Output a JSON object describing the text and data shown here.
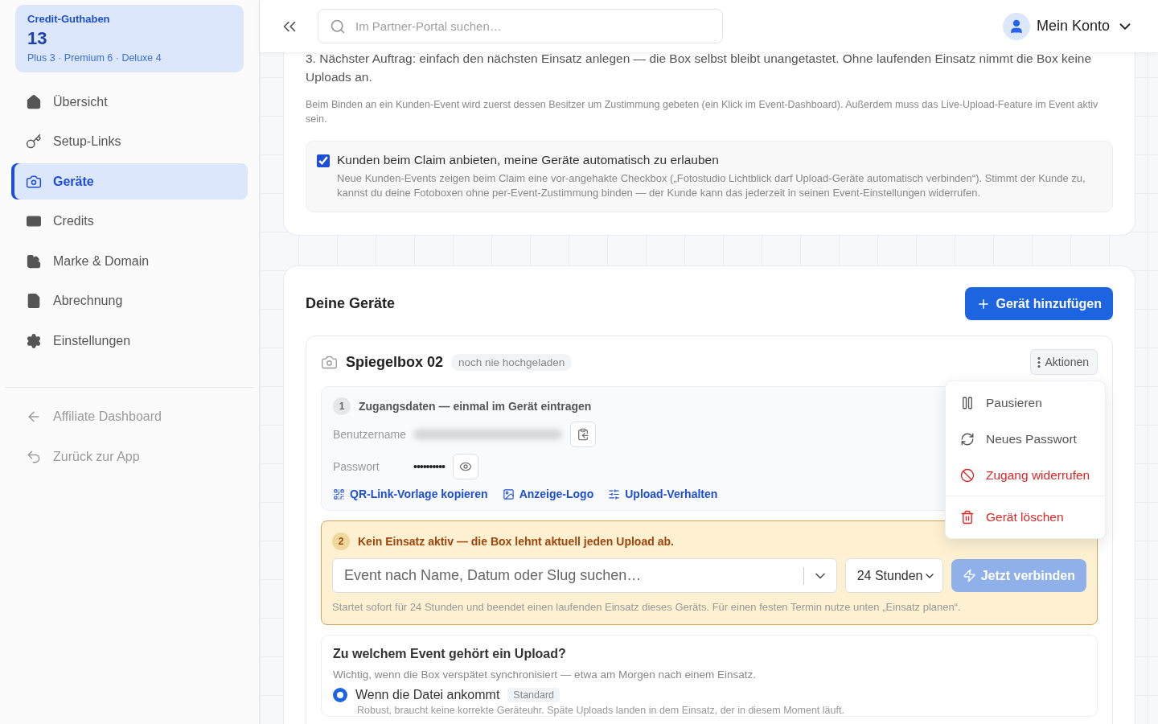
{
  "sidebar": {
    "credit": {
      "title": "Credit-Guthaben",
      "total": "13",
      "breakdown": "Plus 3 · Premium 6 · Deluxe 4"
    },
    "nav": [
      {
        "label": "Übersicht",
        "selected": false
      },
      {
        "label": "Setup-Links",
        "selected": false
      },
      {
        "label": "Geräte",
        "selected": true
      },
      {
        "label": "Credits",
        "selected": false
      },
      {
        "label": "Marke & Domain",
        "selected": false
      },
      {
        "label": "Abrechnung",
        "selected": false
      },
      {
        "label": "Einstellungen",
        "selected": false
      }
    ],
    "footer_links": [
      {
        "label": "Affiliate Dashboard"
      },
      {
        "label": "Zurück zur App"
      }
    ]
  },
  "topbar": {
    "search": {
      "placeholder": "Im Partner-Portal suchen…"
    },
    "account": "Mein Konto"
  },
  "intro": {
    "step_text": "3. Nächster Auftrag: einfach den nächsten Einsatz anlegen — die Box selbst bleibt unangetastet. Ohne laufenden Einsatz nimmt die Box keine Uploads an.",
    "note": "Beim Binden an ein Kunden-Event wird zuerst dessen Besitzer um Zustimmung gebeten (ein Klick im Event-Dashboard). Außerdem muss das Live-Upload-Feature im Event aktiv sein.",
    "consent": {
      "checked": true,
      "label": "Kunden beim Claim anbieten, meine Geräte automatisch zu erlauben",
      "description": "Neue Kunden-Events zeigen beim Claim eine vor-angehakte Checkbox („Fotostudio Lichtblick darf Upload-Geräte automatisch verbinden“). Stimmt der Kunde zu, kannst du deine Fotoboxen ohne per-Event-Zustimmung binden — der Kunde kann das jederzeit in seinen Event-Einstellungen widerrufen."
    }
  },
  "devices": {
    "title": "Deine Geräte",
    "add_button": "Gerät hinzufügen",
    "device": {
      "name": "Spiegelbox 02",
      "status": "noch nie hochgeladen",
      "actions_button": "Aktionen",
      "step1": {
        "number": "1",
        "title": "Zugangsdaten — einmal im Gerät eintragen",
        "username_label": "Benutzername",
        "password_label": "Passwort",
        "password_value": "••••••••••",
        "links": [
          {
            "label": "QR-Link-Vorlage kopieren"
          },
          {
            "label": "Anzeige-Logo"
          },
          {
            "label": "Upload-Verhalten"
          }
        ]
      },
      "step2": {
        "number": "2",
        "warning": "Kein Einsatz aktiv — die Box lehnt aktuell jeden Upload ab.",
        "event_placeholder": "Event nach Name, Datum oder Slug suchen…",
        "duration": "24 Stunden",
        "connect_button": "Jetzt verbinden",
        "connect_disabled": true,
        "hint": "Startet sofort für 24 Stunden und beendet einen laufenden Einsatz dieses Geräts. Für einen festen Termin nutze unten „Einsatz planen“."
      },
      "assignment": {
        "title": "Zu welchem Event gehört ein Upload?",
        "description": "Wichtig, wenn die Box verspätet synchronisiert — etwa am Morgen nach einem Einsatz.",
        "options": [
          {
            "label": "Wenn die Datei ankommt",
            "badge": "Standard",
            "description": "Robust, braucht keine korrekte Geräteuhr. Späte Uploads landen in dem Einsatz, der in diesem Moment läuft.",
            "selected": true
          }
        ]
      }
    },
    "menu": [
      {
        "label": "Pausieren",
        "danger": false
      },
      {
        "label": "Neues Passwort",
        "danger": false
      },
      {
        "label": "Zugang widerrufen",
        "danger": true
      },
      {
        "label": "Gerät löschen",
        "danger": true
      }
    ]
  }
}
